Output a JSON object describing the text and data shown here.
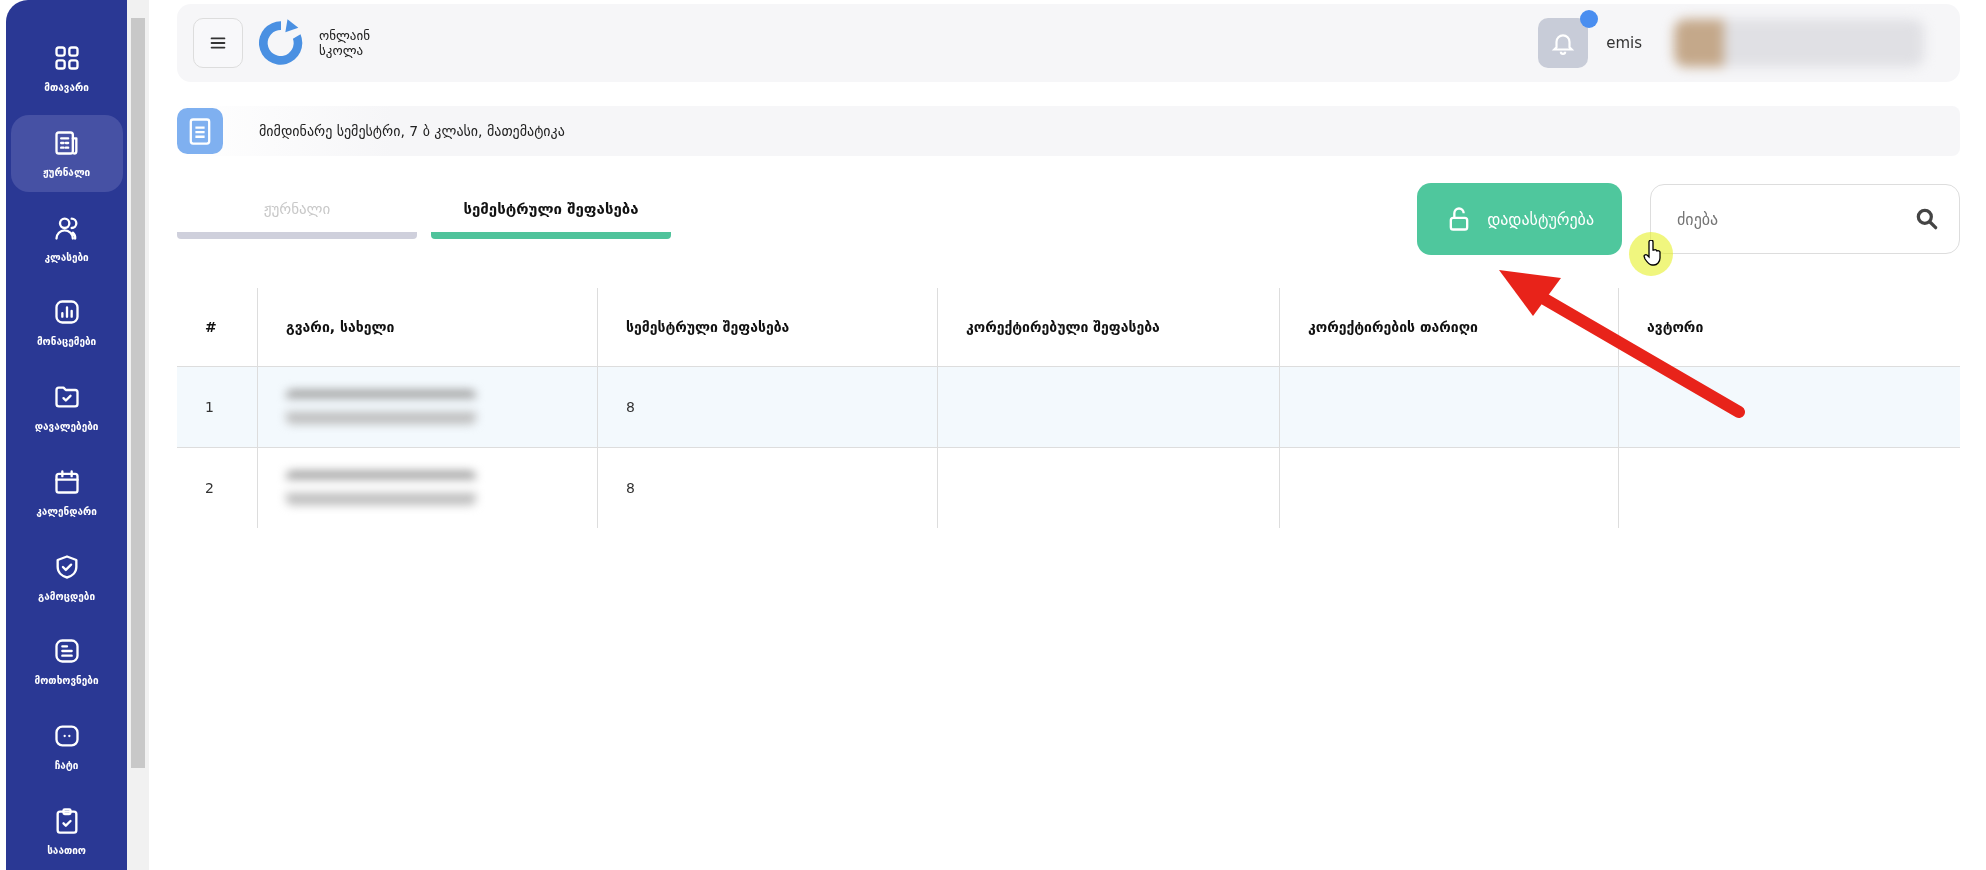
{
  "sidebar": {
    "items": [
      {
        "label": "მთავარი",
        "selected": false
      },
      {
        "label": "ჟურნალი",
        "selected": true
      },
      {
        "label": "კლასები",
        "selected": false
      },
      {
        "label": "მონაცემები",
        "selected": false
      },
      {
        "label": "დავალებები",
        "selected": false
      },
      {
        "label": "კალენდარი",
        "selected": false
      },
      {
        "label": "გამოცდები",
        "selected": false
      },
      {
        "label": "მოთხოვნები",
        "selected": false
      },
      {
        "label": "ჩატი",
        "selected": false
      },
      {
        "label": "საათიო",
        "selected": false
      }
    ]
  },
  "header": {
    "logo_text": [
      "ონლაინ",
      "სკოლა"
    ],
    "user": "emis",
    "notification": true
  },
  "breadcrumb": "მიმდინარე სემესტრი, 7 ბ კლასი, მათემატიკა",
  "tabs": [
    {
      "label": "ჟურნალი",
      "selected": false
    },
    {
      "label": "სემესტრული შეფასება",
      "selected": true
    }
  ],
  "confirm_button": "დადასტურება",
  "search": {
    "placeholder": "ძიება"
  },
  "table": {
    "columns": [
      "#",
      "გვარი, სახელი",
      "სემესტრული შეფასება",
      "კორექტირებული შეფასება",
      "კორექტირების თარიღი",
      "ავტორი"
    ],
    "rows": [
      {
        "number": "1",
        "grade": "8",
        "selected": true
      },
      {
        "number": "2",
        "grade": "8",
        "selected": false
      }
    ]
  }
}
